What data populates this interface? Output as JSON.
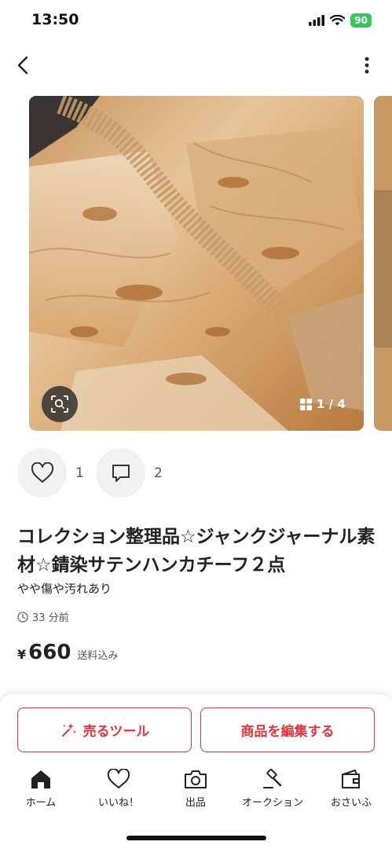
{
  "status_bar": {
    "time": "13:50",
    "battery": "90"
  },
  "product": {
    "likes_count": "1",
    "comments_count": "2",
    "title": "コレクション整理品☆ジャンクジャーナル素材☆錆染サテンハンカチーフ２点",
    "condition": "やや傷や汚れあり",
    "posted_time": "33 分前",
    "currency": "¥",
    "price": "660",
    "shipping": "送料込み"
  },
  "gallery": {
    "indicator": "1 / 4"
  },
  "actions": {
    "sell_tool_label": "売るツール",
    "edit_label": "商品を編集する"
  },
  "tabs": [
    {
      "label": "ホーム",
      "icon": "home-icon"
    },
    {
      "label": "いいね！",
      "icon": "heart-icon"
    },
    {
      "label": "出品",
      "icon": "camera-icon"
    },
    {
      "label": "オークション",
      "icon": "gavel-icon"
    },
    {
      "label": "おさいふ",
      "icon": "wallet-icon"
    }
  ],
  "colors": {
    "accent": "#e8323c",
    "battery": "#34c759"
  }
}
